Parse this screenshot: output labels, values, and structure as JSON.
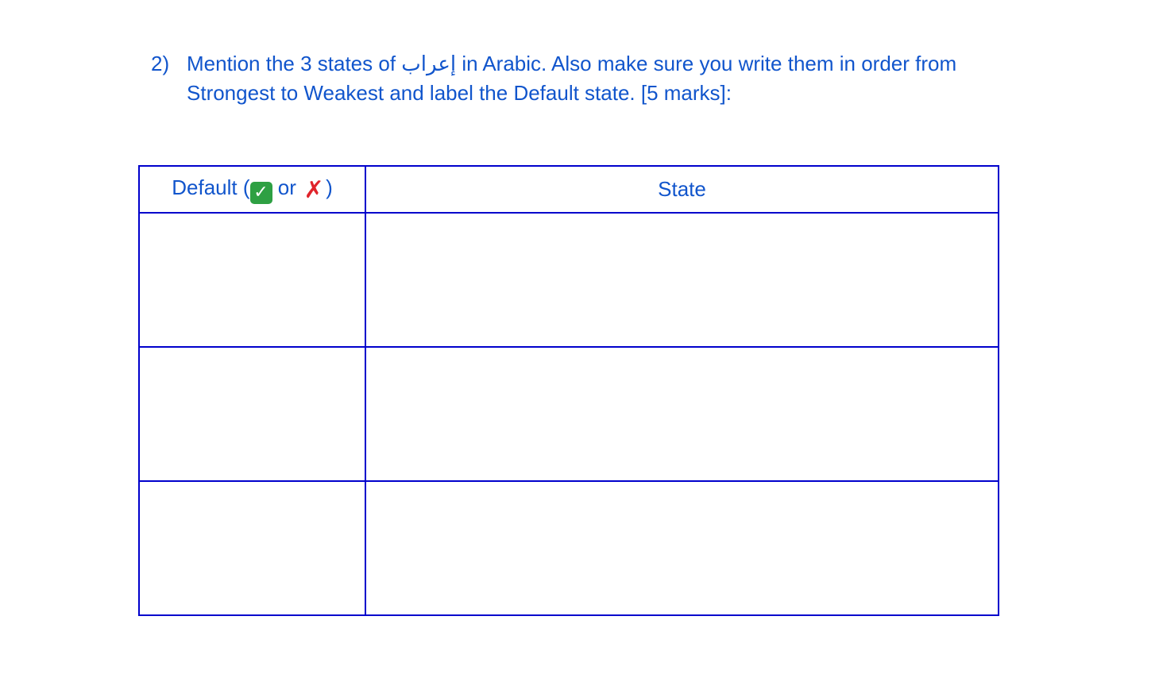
{
  "question": {
    "number": "2)",
    "text_before": "Mention the 3 states of",
    "arabic_word": "إعراب",
    "text_after": "in Arabic. Also make sure you write them in order from Strongest to Weakest and label the Default state. [5 marks]:"
  },
  "table": {
    "header_default_prefix": "Default (",
    "check_icon": "✓",
    "or_text": "or",
    "cross_icon": "✗",
    "header_default_suffix": ")",
    "header_state": "State",
    "rows": [
      {
        "default": "",
        "state": ""
      },
      {
        "default": "",
        "state": ""
      },
      {
        "default": "",
        "state": ""
      }
    ]
  },
  "colors": {
    "text": "#1155cc",
    "table_border": "#0000cc",
    "check_green": "#2ea043",
    "cross_red": "#e0242b"
  }
}
